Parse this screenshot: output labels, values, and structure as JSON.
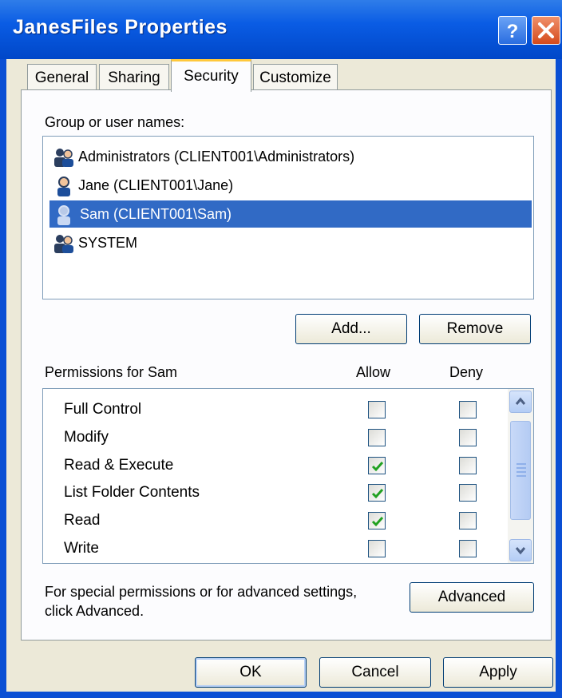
{
  "window": {
    "title": "JanesFiles Properties"
  },
  "tabs": [
    {
      "label": "General"
    },
    {
      "label": "Sharing"
    },
    {
      "label": "Security",
      "active": true
    },
    {
      "label": "Customize"
    }
  ],
  "security": {
    "group_label": "Group or user names:",
    "users": [
      {
        "name": "Administrators (CLIENT001\\Administrators)",
        "icon": "user-group-icon"
      },
      {
        "name": "Jane (CLIENT001\\Jane)",
        "icon": "user-icon"
      },
      {
        "name": "Sam (CLIENT001\\Sam)",
        "icon": "user-icon",
        "selected": true
      },
      {
        "name": "SYSTEM",
        "icon": "user-group-icon"
      }
    ],
    "add_label": "Add...",
    "remove_label": "Remove",
    "permissions_label": "Permissions for Sam",
    "allow_header": "Allow",
    "deny_header": "Deny",
    "permissions": [
      {
        "name": "Full Control",
        "allow": false,
        "deny": false
      },
      {
        "name": "Modify",
        "allow": false,
        "deny": false
      },
      {
        "name": "Read & Execute",
        "allow": true,
        "deny": false
      },
      {
        "name": "List Folder Contents",
        "allow": true,
        "deny": false
      },
      {
        "name": "Read",
        "allow": true,
        "deny": false
      },
      {
        "name": "Write",
        "allow": false,
        "deny": false
      }
    ],
    "advanced_text_line1": "For special permissions or for advanced settings,",
    "advanced_text_line2": "click Advanced.",
    "advanced_label": "Advanced"
  },
  "footer": {
    "ok_label": "OK",
    "cancel_label": "Cancel",
    "apply_label": "Apply"
  },
  "colors": {
    "titlebar": "#0a5ce4",
    "selection": "#316ac5",
    "check": "#21a121",
    "tab_highlight": "#ffc83c"
  }
}
